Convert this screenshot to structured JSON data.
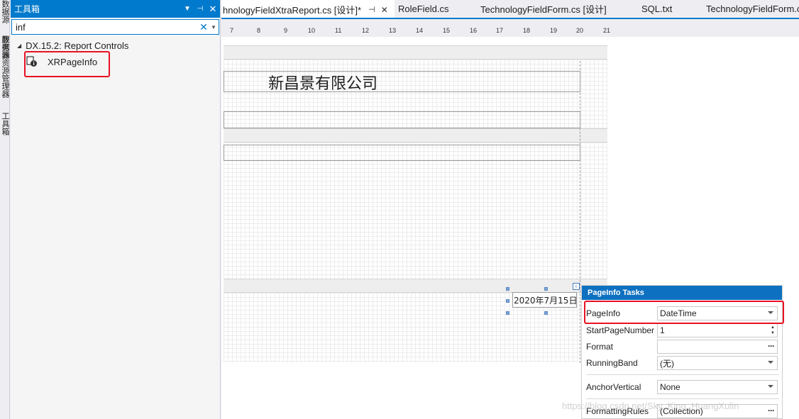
{
  "side_tabs": [
    "数据源",
    "服务器资源管理器",
    "工具箱"
  ],
  "toolbox": {
    "title": "工具箱",
    "search_value": "inf",
    "group_label": "DX.15.2: Report Controls",
    "item_label": "XRPageInfo"
  },
  "doc_tabs": [
    "hnologyFieldXtraReport.cs [设计]*",
    "RoleField.cs",
    "TechnologyFieldForm.cs [设计]",
    "SQL.txt",
    "TechnologyFieldForm.c"
  ],
  "ruler": [
    "7",
    "8",
    "9",
    "10",
    "11",
    "12",
    "13",
    "14",
    "15",
    "16",
    "17",
    "18",
    "19",
    "20",
    "21"
  ],
  "report": {
    "company_title": "新昌景有限公司",
    "date_value": "2020年7月15日"
  },
  "tasks": {
    "title": "PageInfo Tasks",
    "rows": [
      {
        "label": "PageInfo",
        "value": "DateTime"
      },
      {
        "label": "StartPageNumber",
        "value": "1"
      },
      {
        "label": "Format",
        "value": ""
      },
      {
        "label": "RunningBand",
        "value": "(无)"
      },
      {
        "label": "AnchorVertical",
        "value": "None"
      },
      {
        "label": "FormattingRules",
        "value": "(Collection)"
      }
    ]
  },
  "watermark": "https://blog.csdn.net/Sky_King_HuangXulin",
  "colors": {
    "accent": "#007acc",
    "highlight": "#e81123",
    "tasks_header": "#0e70c0"
  }
}
